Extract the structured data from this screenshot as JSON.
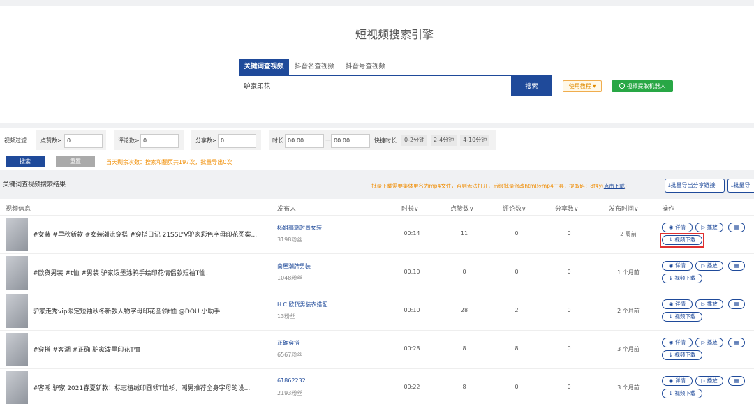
{
  "page_title": "短视频搜索引擎",
  "tabs": [
    {
      "label": "关键词查视频",
      "active": true
    },
    {
      "label": "抖音名查视频",
      "active": false
    },
    {
      "label": "抖音号查视频",
      "active": false
    }
  ],
  "search": {
    "value": "驴家印花",
    "button": "搜索"
  },
  "tutorial_button": "使用教程 ▾",
  "robot_button": "视频提取机器人",
  "filter": {
    "label": "视频过滤",
    "likes_label": "点赞数≥",
    "likes_value": "0",
    "comments_label": "评论数≥",
    "comments_value": "0",
    "shares_label": "分享数≥",
    "shares_value": "0",
    "duration_label": "时长",
    "duration_from": "00:00",
    "duration_sep": "—",
    "duration_to": "00:00",
    "quick_label": "快捷时长",
    "quick_options": [
      "0-2分钟",
      "2-4分钟",
      "4-10分钟"
    ],
    "search_button": "搜索",
    "reset_button": "重置",
    "quota": "当天剩余次数：搜索和翻页共197次，批量导出0次"
  },
  "results": {
    "title": "关键词查视频搜索结果",
    "notice": "批量下载需要集体更名为mp4文件，否则无法打开，后缀批量修改html转mp4工具，提取码：8f4y(",
    "notice_link": "点击下载",
    "notice_end": ")",
    "export_share_button": "批量导出分享链接",
    "export_button": "批量导"
  },
  "columns": [
    "视频信息",
    "发布人",
    "时长",
    "点赞数",
    "评论数",
    "分享数",
    "发布时间",
    "操作"
  ],
  "actions": {
    "detail": "详情",
    "play": "播放",
    "download": "视频下载"
  },
  "rows": [
    {
      "title": "#女装 #早秋新款 #女装潮流穿搭 #穿搭日记 21SSL“V驴家彩色字母印花图案...",
      "author": "杨姐高端时尚女装",
      "fans": "3198粉丝",
      "duration": "00:14",
      "likes": "11",
      "comments": "0",
      "shares": "0",
      "time": "2 周前"
    },
    {
      "title": "#欧货男装 #t恤 #男装 驴家泼墨涂鸦手绘印花情侣款短袖T恤！",
      "author": "南屋潮牌男装",
      "fans": "1048粉丝",
      "duration": "00:10",
      "likes": "0",
      "comments": "0",
      "shares": "0",
      "time": "1 个月前"
    },
    {
      "title": "驴家走秀vip限定短袖秋冬新款人物字母印花圆领t恤 @DOU 小助手",
      "author": "H.C 欧货男装衣搭配",
      "fans": "13粉丝",
      "duration": "00:10",
      "likes": "28",
      "comments": "2",
      "shares": "0",
      "time": "2 个月前"
    },
    {
      "title": "#穿搭 #客潮 #正确 驴家泼墨印花T恤",
      "author": "正确穿搭",
      "fans": "6567粉丝",
      "duration": "00:28",
      "likes": "8",
      "comments": "8",
      "shares": "0",
      "time": "3 个月前"
    },
    {
      "title": "#客潮 驴家 2021春夏新款！标志植绒印圆领T恤衫，潮男推荐全身字母的设...",
      "author": "61862232",
      "fans": "2193粉丝",
      "duration": "00:22",
      "likes": "8",
      "comments": "0",
      "shares": "0",
      "time": "3 个月前"
    }
  ]
}
